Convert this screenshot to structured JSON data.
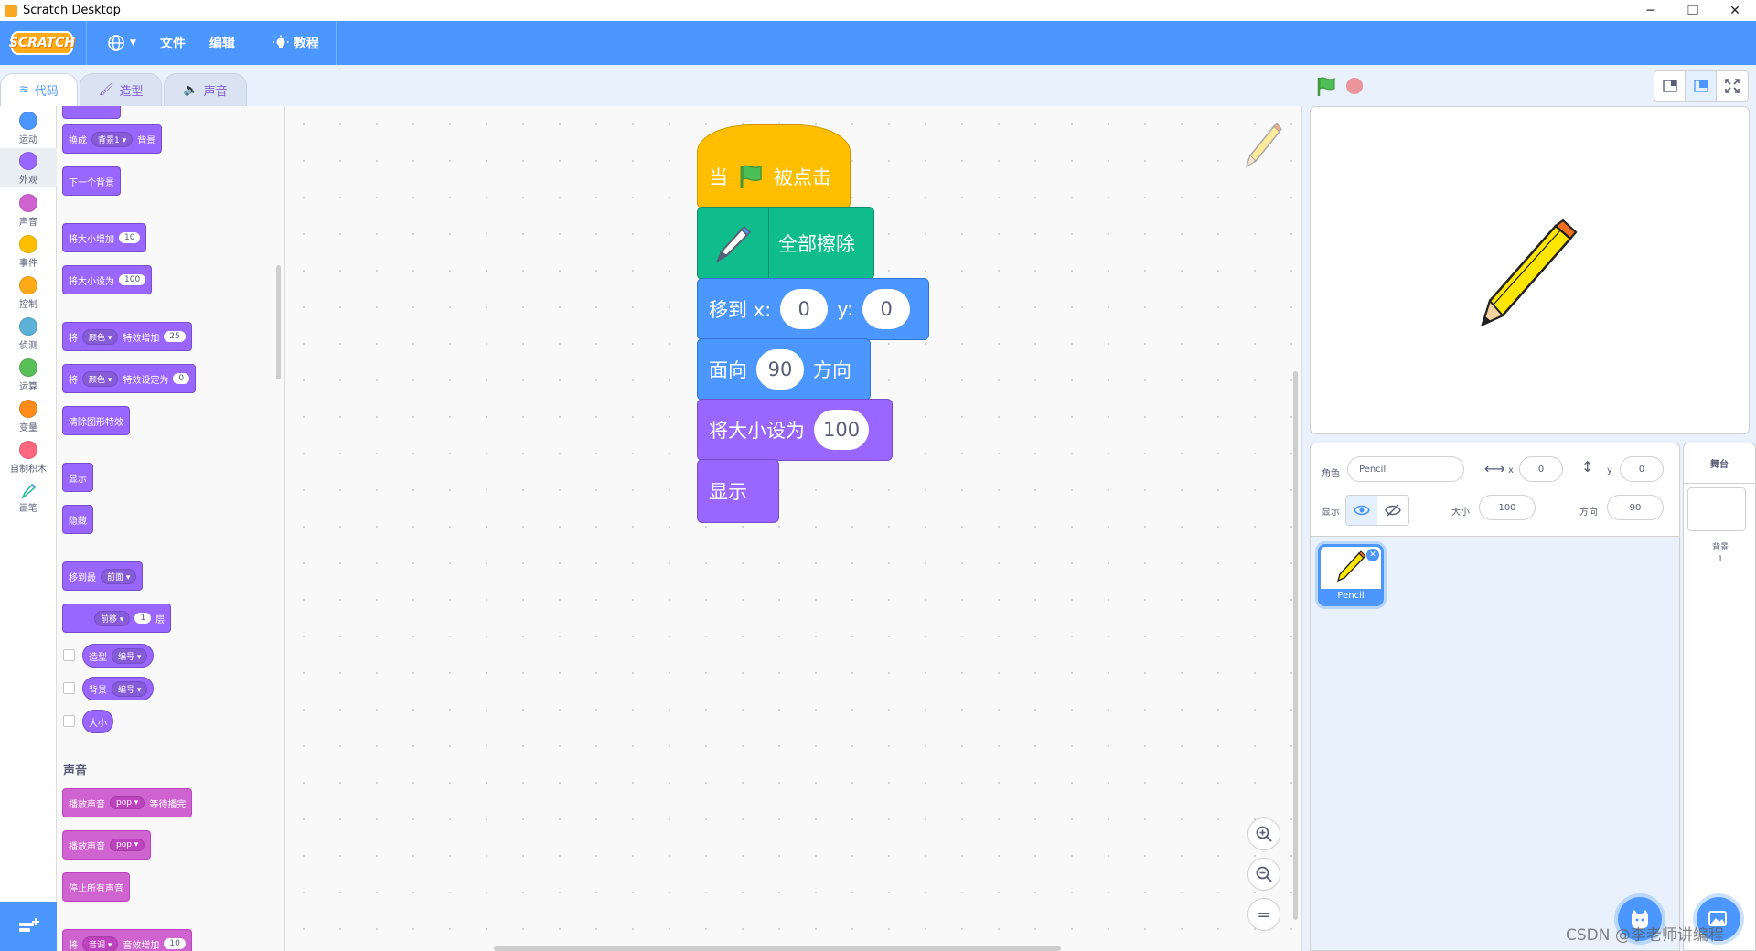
{
  "window": {
    "title": "Scratch Desktop",
    "minimize": "─",
    "maximize": "❐",
    "close": "✕"
  },
  "menubar": {
    "logo": "SCRATCH",
    "file": "文件",
    "edit": "编辑",
    "tutorials": "教程"
  },
  "tabs": {
    "code": "代码",
    "costumes": "造型",
    "sounds": "声音"
  },
  "categories": [
    {
      "label": "运动",
      "color": "#4c97ff"
    },
    {
      "label": "外观",
      "color": "#9966ff"
    },
    {
      "label": "声音",
      "color": "#cf63cf"
    },
    {
      "label": "事件",
      "color": "#ffbf00"
    },
    {
      "label": "控制",
      "color": "#ffab19"
    },
    {
      "label": "侦测",
      "color": "#5cb1d6"
    },
    {
      "label": "运算",
      "color": "#59c059"
    },
    {
      "label": "变量",
      "color": "#ff8c1a"
    },
    {
      "label": "自制积木",
      "color": "#ff6680"
    },
    {
      "label": "画笔",
      "color": "#0fbd8c"
    }
  ],
  "palette": {
    "switch_backdrop": {
      "label1": "换成",
      "dropdown": "背景1",
      "label2": "背景"
    },
    "next_backdrop": "下一个背景",
    "change_size": {
      "label": "将大小增加",
      "value": "10"
    },
    "set_size": {
      "label": "将大小设为",
      "value": "100"
    },
    "change_effect": {
      "label1": "将",
      "dropdown": "颜色",
      "label2": "特效增加",
      "value": "25"
    },
    "set_effect": {
      "label1": "将",
      "dropdown": "颜色",
      "label2": "特效设定为",
      "value": "0"
    },
    "clear_effects": "清除图形特效",
    "show": "显示",
    "hide": "隐藏",
    "go_to_layer": {
      "label": "移到最",
      "dropdown": "前面"
    },
    "go_layers": {
      "dropdown": "前移",
      "value": "1",
      "label": "层"
    },
    "costume_reporter": {
      "label": "造型",
      "dropdown": "编号"
    },
    "backdrop_reporter": {
      "label": "背景",
      "dropdown": "编号"
    },
    "size_reporter": "大小",
    "sound_heading": "声音",
    "play_until_done": {
      "label1": "播放声音",
      "dropdown": "pop",
      "label2": "等待播完"
    },
    "start_sound": {
      "label": "播放声音",
      "dropdown": "pop"
    },
    "stop_all_sounds": "停止所有声音",
    "change_sound_effect": {
      "label1": "将",
      "dropdown": "音调",
      "label2": "音效增加",
      "value": "10"
    }
  },
  "script": {
    "hat": {
      "label1": "当",
      "label2": "被点击"
    },
    "erase_all": "全部擦除",
    "goto": {
      "label": "移到 x:",
      "x": "0",
      "ylabel": "y:",
      "y": "0"
    },
    "point": {
      "label1": "面向",
      "value": "90",
      "label2": "方向"
    },
    "set_size": {
      "label": "将大小设为",
      "value": "100"
    },
    "show": "显示"
  },
  "zoom": {
    "in": "+",
    "out": "−",
    "reset": "="
  },
  "sprite_info": {
    "sprite_label": "角色",
    "sprite_name": "Pencil",
    "x_label": "x",
    "x": "0",
    "y_label": "y",
    "y": "0",
    "show_label": "显示",
    "size_label": "大小",
    "size": "100",
    "direction_label": "方向",
    "direction": "90"
  },
  "sprite_list": [
    {
      "name": "Pencil"
    }
  ],
  "stage_pane": {
    "header": "舞台",
    "backdrops_label": "背景",
    "backdrops_count": "1"
  },
  "watermark": "CSDN @李老师讲编程"
}
